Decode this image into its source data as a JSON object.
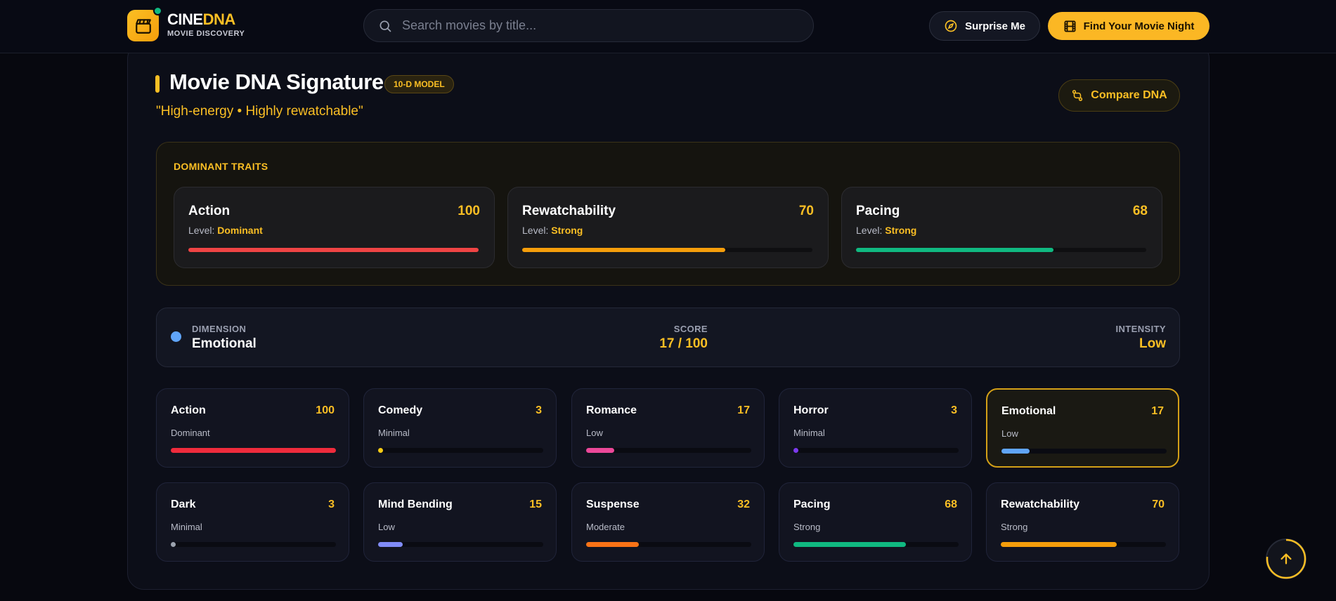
{
  "brand": {
    "part1": "CINE",
    "part2": "DNA",
    "subtitle": "MOVIE DISCOVERY"
  },
  "search": {
    "placeholder": "Search movies by title..."
  },
  "header_buttons": {
    "surprise": "Surprise Me",
    "find": "Find Your Movie Night"
  },
  "signature": {
    "title": "Movie DNA Signature",
    "badge": "10-D MODEL",
    "tagline": "\"High-energy • Highly rewatchable\"",
    "compare_label": "Compare DNA"
  },
  "dominant": {
    "heading": "DOMINANT TRAITS",
    "level_prefix": "Level: ",
    "traits": [
      {
        "name": "Action",
        "score": "100",
        "level": "Dominant",
        "percent": 100,
        "color": "#ef4444"
      },
      {
        "name": "Rewatchability",
        "score": "70",
        "level": "Strong",
        "percent": 70,
        "color": "#f59e0b"
      },
      {
        "name": "Pacing",
        "score": "68",
        "level": "Strong",
        "percent": 68,
        "color": "#10b981"
      }
    ]
  },
  "selected": {
    "dimension_label": "DIMENSION",
    "dimension": "Emotional",
    "score_label": "SCORE",
    "score": "17 / 100",
    "intensity_label": "INTENSITY",
    "intensity": "Low"
  },
  "dimensions": [
    {
      "name": "Action",
      "score": "100",
      "level": "Dominant",
      "percent": 100,
      "color": "#ef2b3c"
    },
    {
      "name": "Comedy",
      "score": "3",
      "level": "Minimal",
      "percent": 3,
      "color": "#facc15"
    },
    {
      "name": "Romance",
      "score": "17",
      "level": "Low",
      "percent": 17,
      "color": "#ec4899"
    },
    {
      "name": "Horror",
      "score": "3",
      "level": "Minimal",
      "percent": 3,
      "color": "#7c3aed"
    },
    {
      "name": "Emotional",
      "score": "17",
      "level": "Low",
      "percent": 17,
      "color": "#60a5fa",
      "selected": true
    },
    {
      "name": "Dark",
      "score": "3",
      "level": "Minimal",
      "percent": 3,
      "color": "#9ca3af"
    },
    {
      "name": "Mind Bending",
      "score": "15",
      "level": "Low",
      "percent": 15,
      "color": "#818cf8"
    },
    {
      "name": "Suspense",
      "score": "32",
      "level": "Moderate",
      "percent": 32,
      "color": "#f97316"
    },
    {
      "name": "Pacing",
      "score": "68",
      "level": "Strong",
      "percent": 68,
      "color": "#10b981"
    },
    {
      "name": "Rewatchability",
      "score": "70",
      "level": "Strong",
      "percent": 70,
      "color": "#f59e0b"
    }
  ]
}
